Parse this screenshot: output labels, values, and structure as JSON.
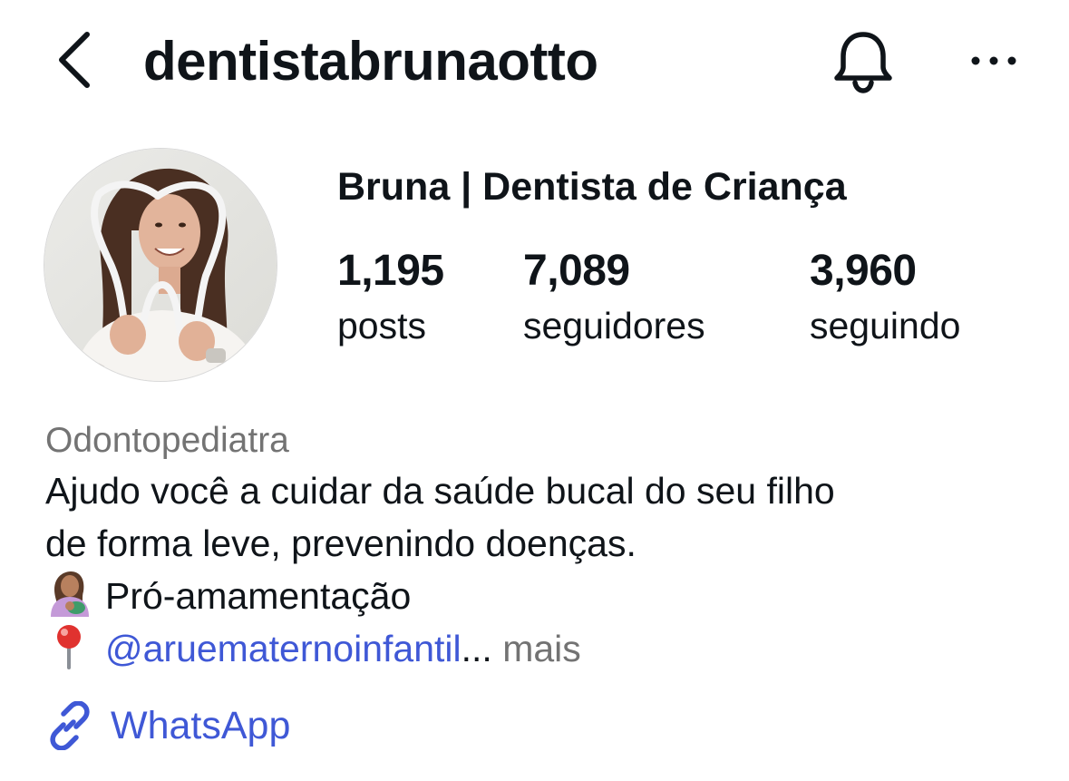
{
  "header": {
    "username": "dentistabrunaotto",
    "back_icon": "chevron-left-icon",
    "bell_icon": "bell-icon",
    "more_icon": "more-horizontal-icon"
  },
  "profile": {
    "display_name": "Bruna | Dentista de Criança",
    "avatar_icon": "profile-photo"
  },
  "stats": [
    {
      "value": "1,195",
      "label": "posts"
    },
    {
      "value": "7,089",
      "label": "seguidores"
    },
    {
      "value": "3,960",
      "label": "seguindo"
    }
  ],
  "bio": {
    "category": "Odontopediatra",
    "line1": "Ajudo você a cuidar da saúde bucal do seu filho",
    "line2": "de forma leve, prevenindo doenças.",
    "line3_emoji": "breastfeeding-emoji",
    "line3_text": "Pró-amamentação",
    "line4_emoji": "round-pushpin-emoji",
    "mention": "@aruematernoinfantil",
    "ellipsis": "...",
    "more": "mais"
  },
  "link": {
    "icon": "link-icon",
    "text": "WhatsApp"
  },
  "colors": {
    "text": "#0f1419",
    "secondary": "#737373",
    "link": "#3f58d6"
  }
}
